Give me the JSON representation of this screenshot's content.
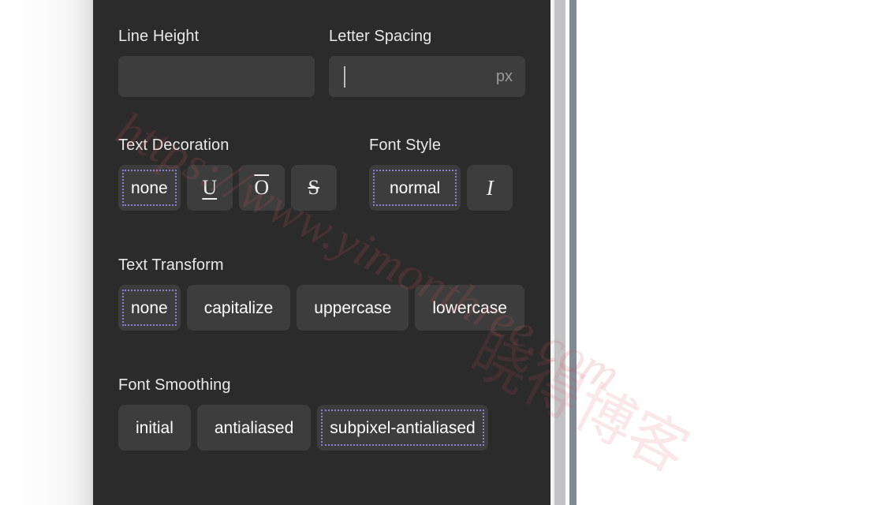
{
  "panel": {
    "background_color": "#2b2b2b",
    "control_background_color": "#3d3d3d",
    "selection_outline_color": "#8c7fd6",
    "text_color": "#e9e9e9"
  },
  "fields": {
    "line_height": {
      "label": "Line Height",
      "value": "",
      "placeholder": ""
    },
    "letter_spacing": {
      "label": "Letter Spacing",
      "value": "",
      "placeholder": "",
      "unit": "px",
      "focused": true
    }
  },
  "text_decoration": {
    "label": "Text Decoration",
    "selected": "none",
    "options": [
      {
        "label": "none",
        "icon": "",
        "selected": true
      },
      {
        "label": "",
        "icon": "U",
        "icon_name": "underline-icon",
        "selected": false
      },
      {
        "label": "",
        "icon": "O",
        "icon_name": "overline-icon",
        "selected": false
      },
      {
        "label": "",
        "icon": "S",
        "icon_name": "line-through-icon",
        "selected": false
      }
    ]
  },
  "font_style": {
    "label": "Font Style",
    "selected": "normal",
    "options": [
      {
        "label": "normal",
        "icon": "",
        "selected": true
      },
      {
        "label": "",
        "icon": "I",
        "icon_name": "italic-icon",
        "selected": false
      }
    ]
  },
  "text_transform": {
    "label": "Text Transform",
    "selected": "none",
    "options": [
      {
        "label": "none",
        "selected": true
      },
      {
        "label": "capitalize",
        "selected": false
      },
      {
        "label": "uppercase",
        "selected": false
      },
      {
        "label": "lowercase",
        "selected": false
      }
    ]
  },
  "font_smoothing": {
    "label": "Font Smoothing",
    "selected": "subpixel-antialiased",
    "options": [
      {
        "label": "initial",
        "selected": false
      },
      {
        "label": "antialiased",
        "selected": false
      },
      {
        "label": "subpixel-antialiased",
        "selected": true
      }
    ]
  },
  "watermark": {
    "url": "https://www.yimonthree.com",
    "site_name": "晓得博客",
    "color": "#d4505c"
  }
}
